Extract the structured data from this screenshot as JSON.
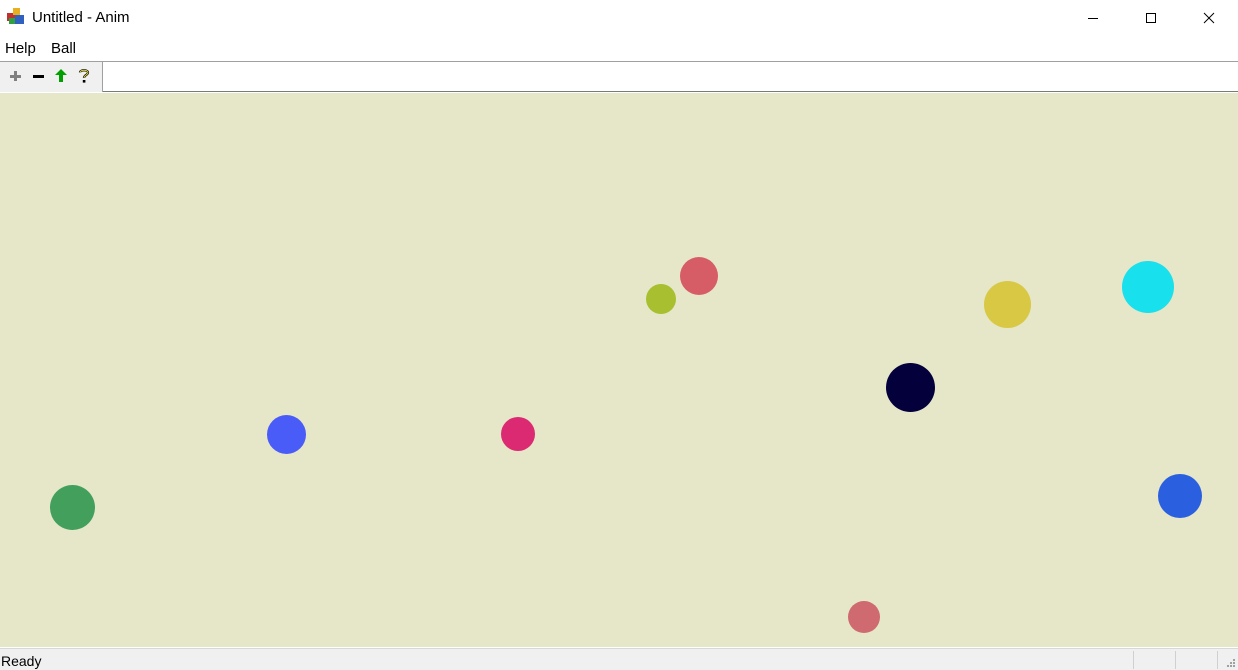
{
  "window": {
    "title": "Untitled - Anim",
    "app_icon": "anim-app-icon",
    "controls": [
      "minimize-icon",
      "maximize-icon",
      "close-icon"
    ]
  },
  "menu": {
    "items": [
      {
        "label": "Help"
      },
      {
        "label": "Ball"
      }
    ]
  },
  "toolbar": {
    "buttons": [
      {
        "icon": "plus-icon",
        "color": "#808080"
      },
      {
        "icon": "minus-icon",
        "color": "#000000"
      },
      {
        "icon": "up-arrow-icon",
        "color": "#00a000"
      },
      {
        "icon": "help-icon",
        "color": "#000000"
      }
    ]
  },
  "canvas": {
    "background": "#e6e6c8",
    "balls": [
      {
        "color": "#d65c66"
      },
      {
        "color": "#a8c030"
      },
      {
        "color": "#d8c844"
      },
      {
        "color": "#18e0ec"
      },
      {
        "color": "#04003c"
      },
      {
        "color": "#4a5cf8"
      },
      {
        "color": "#dc2a72"
      },
      {
        "color": "#42a05c"
      },
      {
        "color": "#2a60e0"
      },
      {
        "color": "#ce6a70"
      }
    ]
  },
  "status": {
    "text": "Ready"
  }
}
